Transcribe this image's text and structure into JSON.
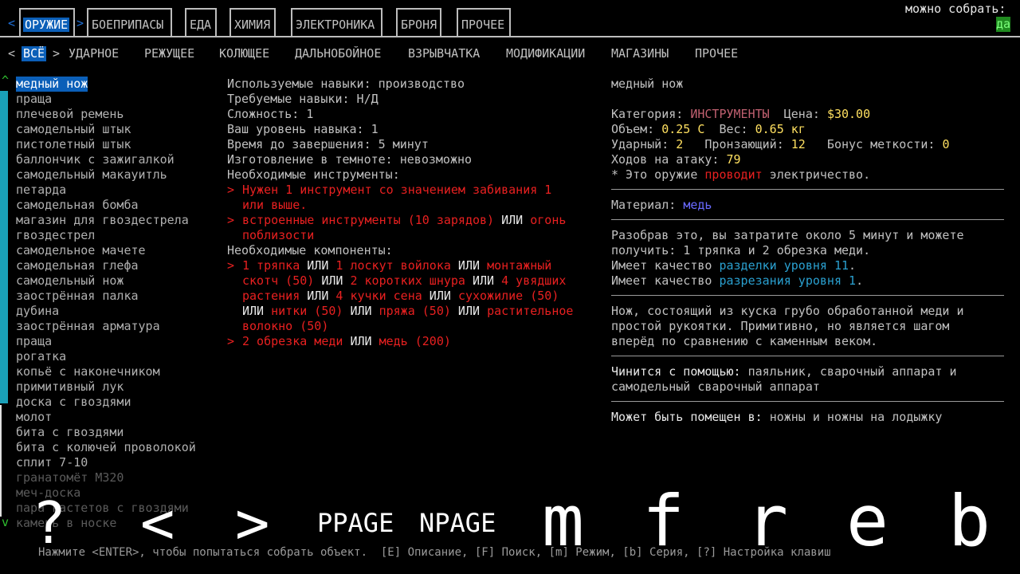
{
  "tabs": [
    {
      "label": "ОРУЖИЕ",
      "selected": true
    },
    {
      "label": "БОЕПРИПАСЫ"
    },
    {
      "label": "ЕДА"
    },
    {
      "label": "ХИМИЯ"
    },
    {
      "label": "ЭЛЕКТРОНИКА"
    },
    {
      "label": "БРОНЯ"
    },
    {
      "label": "ПРОЧЕЕ"
    }
  ],
  "can_craft_label": "можно собрать:",
  "can_craft_value": "да",
  "subtabs": [
    "ВСЁ",
    "УДАРНОЕ",
    "РЕЖУЩЕЕ",
    "КОЛЮЩЕЕ",
    "ДАЛЬНОБОЙНОЕ",
    "ВЗРЫВЧАТКА",
    "МОДИФИКАЦИИ",
    "МАГАЗИНЫ",
    "ПРОЧЕЕ"
  ],
  "arrows": {
    "left": "<",
    "right": ">"
  },
  "scroll": {
    "up": "^",
    "down": "v"
  },
  "recipes": [
    "медный нож",
    "праща",
    "плечевой ремень",
    "самодельный штык",
    "пистолетный штык",
    "баллончик с зажигалкой",
    "самодельный макауитль",
    "петарда",
    "самодельная бомба",
    "магазин для гвоздестрела",
    "гвоздестрел",
    "самодельное мачете",
    "самодельная глефа",
    "самодельный нож",
    "заострённая палка",
    "дубина",
    "заострённая арматура",
    "праща",
    "рогатка",
    "копьё с наконечником",
    "примитивный лук",
    "доска с гвоздями",
    "молот",
    "бита с гвоздями",
    "бита с колючей проволокой",
    "сплит 7-10",
    "гранатомёт M320",
    "меч-доска",
    "пара кастетов с гвоздями",
    "камень в носке"
  ],
  "requirements": {
    "skills_used": "Используемые навыки: производство",
    "skills_required": "Требуемые навыки: Н/Д",
    "difficulty": "Сложность: 1",
    "your_level": "Ваш уровень навыка: 1",
    "time": "Время до завершения: 5 минут",
    "dark": "Изготовление в темноте: невозможно",
    "tools_header": "Необходимые инструменты:",
    "tool1_line1": "Нужен 1 инструмент со значением забивания 1",
    "tool1_line2": "или выше.",
    "tool2_a": "встроенные инструменты (10 зарядов)",
    "tool2_or": " ИЛИ ",
    "tool2_b": "огонь",
    "tool2_line2": "поблизости",
    "components_header": "Необходимые компоненты:",
    "comp1_l1": [
      [
        "1 тряпка",
        "red"
      ],
      [
        " ИЛИ ",
        "white"
      ],
      [
        "1 лоскут войлока",
        "red"
      ],
      [
        " ИЛИ ",
        "white"
      ],
      [
        "монтажный",
        "red"
      ]
    ],
    "comp1_l2": [
      [
        "скотч (50)",
        "red"
      ],
      [
        " ИЛИ ",
        "white"
      ],
      [
        "2 коротких шнура",
        "red"
      ],
      [
        " ИЛИ ",
        "white"
      ],
      [
        "4 увядших",
        "red"
      ]
    ],
    "comp1_l3": [
      [
        "растения",
        "red"
      ],
      [
        " ИЛИ ",
        "white"
      ],
      [
        "4 кучки сена",
        "red"
      ],
      [
        " ИЛИ ",
        "white"
      ],
      [
        "сухожилие (50)",
        "red"
      ]
    ],
    "comp1_l4": [
      [
        "ИЛИ ",
        "white"
      ],
      [
        "нитки (50)",
        "red"
      ],
      [
        " ИЛИ ",
        "white"
      ],
      [
        "пряжа (50)",
        "red"
      ],
      [
        " ИЛИ ",
        "white"
      ],
      [
        "растительное",
        "red"
      ]
    ],
    "comp1_l5": [
      [
        "волокно (50)",
        "red"
      ]
    ],
    "comp2": [
      [
        "2 обрезка меди",
        "red"
      ],
      [
        " ИЛИ ",
        "white"
      ],
      [
        "медь (200)",
        "red"
      ]
    ]
  },
  "item": {
    "name": "медный нож",
    "category_label": "Категория: ",
    "category": "ИНСТРУМЕНТЫ",
    "price_label": "  Цена: ",
    "price": "$30.00",
    "volume_label": "Объем: ",
    "volume": "0.25 С",
    "weight_label": "  Вес: ",
    "weight": "0.65 кг",
    "bash_label": "Ударный: ",
    "bash": "2",
    "pierce_label": "   Пронзающий: ",
    "pierce": "12",
    "acc_label": "   Бонус меткости: ",
    "acc": "0",
    "moves_label": "Ходов на атаку: ",
    "moves": "79",
    "conduct_a": "* Это оружие ",
    "conduct_b": "проводит",
    "conduct_c": " электричество.",
    "material_label": "Материал: ",
    "material": "медь",
    "disasm_1": "Разобрав это, вы затратите около 5 минут и можете",
    "disasm_2": "получить: 1 тряпка и 2 обрезка меди.",
    "q1_a": "Имеет качество ",
    "q1_b": "разделки уровня 11",
    "q1_c": ".",
    "q2_a": "Имеет качество ",
    "q2_b": "разрезания уровня 1",
    "q2_c": ".",
    "desc_1": "Нож, состоящий из куска грубо обработанной меди и",
    "desc_2": "простой рукоятки. Примитивно, но является шагом",
    "desc_3": "вперёд по сравнению с каменным веком.",
    "repair_label": "Чинится с помощью: ",
    "repair_1": "паяльник, сварочный аппарат и",
    "repair_2": "самодельный сварочный аппарат",
    "holster_label": "Может быть помещен в: ",
    "holster": "ножны и ножны на лодыжку"
  },
  "footer": "Нажмите <ENTER>, чтобы попытаться собрать объект.  [E] Описание, [F] Поиск, [m] Режим, [b] Серия, [?] Настройка клавиш",
  "overlay_keys": [
    "?",
    "<",
    ">",
    "PPAGE",
    "NPAGE",
    "m",
    "f",
    "r",
    "e",
    "b"
  ],
  "colors": {
    "selected_bg": "#0b5fb8",
    "scroll_cyan": "#1aa0b8",
    "red": "#e82020",
    "yellow": "#ffe060"
  }
}
